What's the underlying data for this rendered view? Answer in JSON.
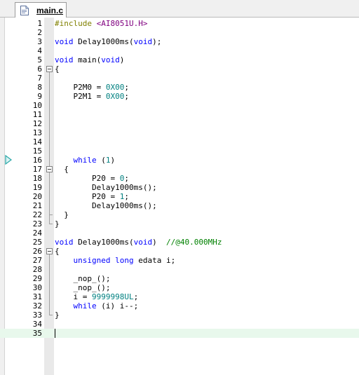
{
  "tab": {
    "label": "main.c",
    "icon": "c-source-file-icon"
  },
  "colors": {
    "keyword": "#0000ff",
    "number": "#008080",
    "preprocessor": "#808000",
    "header": "#800080",
    "comment": "#008000",
    "current_line": "#e8f8ec"
  },
  "editor": {
    "current_line": 35,
    "execution_marker_line": 16,
    "lines": [
      {
        "n": "1",
        "parts": [
          {
            "t": "#include ",
            "c": "inc"
          },
          {
            "t": "<AI8051U.H>",
            "c": "hdr"
          }
        ]
      },
      {
        "n": "2",
        "parts": []
      },
      {
        "n": "3",
        "parts": [
          {
            "t": "void ",
            "c": "kw"
          },
          {
            "t": "Delay1000ms(",
            "c": ""
          },
          {
            "t": "void",
            "c": "kw"
          },
          {
            "t": ");",
            "c": ""
          }
        ]
      },
      {
        "n": "4",
        "parts": []
      },
      {
        "n": "5",
        "parts": [
          {
            "t": "void ",
            "c": "kw"
          },
          {
            "t": "main(",
            "c": ""
          },
          {
            "t": "void",
            "c": "kw"
          },
          {
            "t": ")",
            "c": ""
          }
        ]
      },
      {
        "n": "6",
        "parts": [
          {
            "t": "{",
            "c": ""
          }
        ]
      },
      {
        "n": "7",
        "parts": []
      },
      {
        "n": "8",
        "parts": [
          {
            "t": "    P2M0 = ",
            "c": ""
          },
          {
            "t": "0X00",
            "c": "num"
          },
          {
            "t": ";",
            "c": ""
          }
        ]
      },
      {
        "n": "9",
        "parts": [
          {
            "t": "    P2M1 = ",
            "c": ""
          },
          {
            "t": "0X00",
            "c": "num"
          },
          {
            "t": ";",
            "c": ""
          }
        ]
      },
      {
        "n": "10",
        "parts": []
      },
      {
        "n": "11",
        "parts": []
      },
      {
        "n": "12",
        "parts": []
      },
      {
        "n": "13",
        "parts": []
      },
      {
        "n": "14",
        "parts": []
      },
      {
        "n": "15",
        "parts": []
      },
      {
        "n": "16",
        "parts": [
          {
            "t": "    ",
            "c": ""
          },
          {
            "t": "while",
            "c": "kw"
          },
          {
            "t": " (",
            "c": ""
          },
          {
            "t": "1",
            "c": "num"
          },
          {
            "t": ")",
            "c": ""
          }
        ]
      },
      {
        "n": "17",
        "parts": [
          {
            "t": "  {",
            "c": ""
          }
        ]
      },
      {
        "n": "18",
        "parts": [
          {
            "t": "        P20 = ",
            "c": ""
          },
          {
            "t": "0",
            "c": "num"
          },
          {
            "t": ";",
            "c": ""
          }
        ]
      },
      {
        "n": "19",
        "parts": [
          {
            "t": "        Delay1000ms();",
            "c": ""
          }
        ]
      },
      {
        "n": "20",
        "parts": [
          {
            "t": "        P20 = ",
            "c": ""
          },
          {
            "t": "1",
            "c": "num"
          },
          {
            "t": ";",
            "c": ""
          }
        ]
      },
      {
        "n": "21",
        "parts": [
          {
            "t": "        Delay1000ms();",
            "c": ""
          }
        ]
      },
      {
        "n": "22",
        "parts": [
          {
            "t": "  }",
            "c": ""
          }
        ]
      },
      {
        "n": "23",
        "parts": [
          {
            "t": "}",
            "c": ""
          }
        ]
      },
      {
        "n": "24",
        "parts": []
      },
      {
        "n": "25",
        "parts": [
          {
            "t": "void ",
            "c": "kw"
          },
          {
            "t": "Delay1000ms(",
            "c": ""
          },
          {
            "t": "void",
            "c": "kw"
          },
          {
            "t": ")  ",
            "c": ""
          },
          {
            "t": "//@40.000MHz",
            "c": "cmt"
          }
        ]
      },
      {
        "n": "26",
        "parts": [
          {
            "t": "{",
            "c": ""
          }
        ]
      },
      {
        "n": "27",
        "parts": [
          {
            "t": "    ",
            "c": ""
          },
          {
            "t": "unsigned long",
            "c": "kw"
          },
          {
            "t": " edata i;",
            "c": ""
          }
        ]
      },
      {
        "n": "28",
        "parts": []
      },
      {
        "n": "29",
        "parts": [
          {
            "t": "    _nop_();",
            "c": ""
          }
        ]
      },
      {
        "n": "30",
        "parts": [
          {
            "t": "    _nop_();",
            "c": ""
          }
        ]
      },
      {
        "n": "31",
        "parts": [
          {
            "t": "    i = ",
            "c": ""
          },
          {
            "t": "9999998UL",
            "c": "num"
          },
          {
            "t": ";",
            "c": ""
          }
        ]
      },
      {
        "n": "32",
        "parts": [
          {
            "t": "    ",
            "c": ""
          },
          {
            "t": "while",
            "c": "kw"
          },
          {
            "t": " (i) i--;",
            "c": ""
          }
        ]
      },
      {
        "n": "33",
        "parts": [
          {
            "t": "}",
            "c": ""
          }
        ]
      },
      {
        "n": "34",
        "parts": []
      },
      {
        "n": "35",
        "parts": []
      }
    ]
  }
}
